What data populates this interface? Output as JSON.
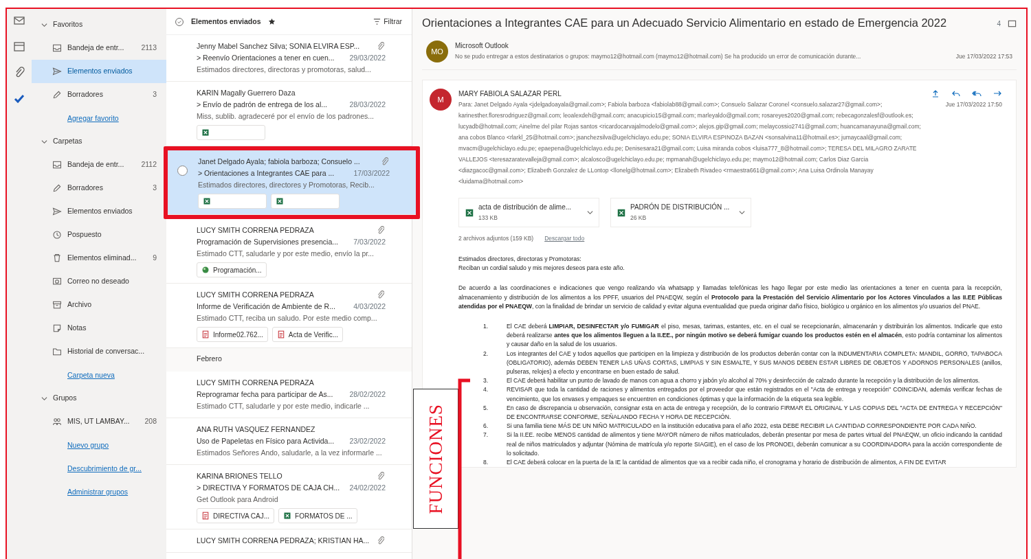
{
  "rail": [
    {
      "kind": "mail"
    },
    {
      "kind": "calendar"
    },
    {
      "kind": "attach"
    },
    {
      "kind": "todo"
    }
  ],
  "folder_sections": [
    {
      "title": "Favoritos",
      "expanded": true,
      "items": [
        {
          "kind": "inbox",
          "label": "Bandeja de entr...",
          "count": "2113",
          "selected": false
        },
        {
          "kind": "sent",
          "label": "Elementos enviados",
          "selected": true
        },
        {
          "kind": "drafts",
          "label": "Borradores",
          "count": "3",
          "selected": false
        }
      ],
      "action": "Agregar favorito"
    },
    {
      "title": "Carpetas",
      "expanded": true,
      "items": [
        {
          "kind": "inbox",
          "label": "Bandeja de entr...",
          "count": "2112",
          "selected": false
        },
        {
          "kind": "drafts",
          "label": "Borradores",
          "count": "3",
          "selected": false
        },
        {
          "kind": "sent",
          "label": "Elementos enviados",
          "selected": false
        },
        {
          "kind": "snooze",
          "label": "Pospuesto",
          "selected": false
        },
        {
          "kind": "trash",
          "label": "Elementos eliminad...",
          "count": "9",
          "selected": false
        },
        {
          "kind": "junk",
          "label": "Correo no deseado",
          "selected": false
        },
        {
          "kind": "archive",
          "label": "Archivo",
          "selected": false
        },
        {
          "kind": "notes",
          "label": "Notas",
          "selected": false
        },
        {
          "kind": "folder",
          "label": "Historial de conversac...",
          "selected": false
        }
      ],
      "action": "Carpeta nueva"
    },
    {
      "title": "Grupos",
      "expanded": true,
      "items": [
        {
          "kind": "group",
          "label": "MIS, UT LAMBAY...",
          "count": "208",
          "selected": false
        }
      ],
      "actions": [
        "Nuevo grupo",
        "Descubrimiento de gr...",
        "Administrar grupos"
      ]
    }
  ],
  "message_list": {
    "title": "Elementos enviados",
    "filter": "Filtrar",
    "groups": [
      {
        "messages": [
          {
            "sender": "Jenny Mabel Sanchez Silva; SONIA ELVIRA ESP...",
            "subject": "> Reenvío Orientaciones a tener en cuen...",
            "date": "29/03/2022",
            "preview": "Estimados directores, directoras y promotoras, salud...",
            "has_attachment": true,
            "selected": false
          },
          {
            "sender": "KARIN Magally Guerrero Daza",
            "subject": "> Envío de padrón de entrega de los al...",
            "date": "28/03/2022",
            "preview": "Miss, sublib. agradeceré por el envío de los padrones...",
            "has_attachment": false,
            "selected": false,
            "attachments": [
              {
                "kind": "excel"
              }
            ]
          },
          {
            "sender": "Janet Delgado Ayala; fabiola barboza; Consuelo ...",
            "subject": "> Orientaciones a Integrantes CAE para ...",
            "date": "17/03/2022",
            "preview": "Estimados directores, directores y Promotoras, Recib...",
            "has_attachment": true,
            "selected": true,
            "attachments": [
              {
                "kind": "excel"
              },
              {
                "kind": "excel"
              }
            ]
          },
          {
            "sender": "LUCY SMITH CORRENA PEDRAZA",
            "subject": "Programación de Supervisiones presencia...",
            "date": "7/03/2022",
            "preview": "Estimado CTT, saludarle y por este medio, envío la pr...",
            "has_attachment": true,
            "selected": false,
            "attachments": [
              {
                "kind": "image",
                "label": "Programación..."
              }
            ]
          },
          {
            "sender": "LUCY SMITH CORRENA PEDRAZA",
            "subject": "Informe de Verificación de Ambiente de R...",
            "date": "4/03/2022",
            "preview": "Estimado CTT, reciba un saludo. Por este medio comp...",
            "has_attachment": true,
            "selected": false,
            "attachments": [
              {
                "kind": "pdf",
                "label": "Informe02.762..."
              },
              {
                "kind": "pdf",
                "label": "Acta de Verific..."
              }
            ]
          }
        ]
      },
      {
        "title": "Febrero",
        "messages": [
          {
            "sender": "LUCY SMITH CORRENA PEDRAZA",
            "subject": "Reprogramar fecha para participar de As...",
            "date": "28/02/2022",
            "preview": "Estimado CTT, saludarle y por este medio, indicarle ...",
            "has_attachment": false,
            "selected": false
          },
          {
            "sender": "ANA RUTH VASQUEZ FERNANDEZ",
            "subject": "Uso de Papeletas en Físico para Activida...",
            "date": "23/02/2022",
            "preview": "Estimados Señores Ando, saludarle, a la vez informarle ...",
            "has_attachment": false,
            "selected": false
          },
          {
            "sender": "KARINA BRIONES TELLO",
            "subject": "> DIRECTIVA Y FORMATOS DE CAJA CH...",
            "date": "24/02/2022",
            "preview": "Get Outlook para Android",
            "has_attachment": true,
            "selected": false,
            "attachments": [
              {
                "kind": "pdf",
                "label": "DIRECTIVA CAJ..."
              },
              {
                "kind": "excel",
                "label": "FORMATOS DE ..."
              }
            ]
          },
          {
            "sender": "LUCY SMITH CORRENA PEDRAZA; KRISTIAN HA...",
            "has_attachment": true,
            "selected": false
          }
        ]
      }
    ]
  },
  "reading_pane": {
    "title": "Orientaciones a Integrantes CAE para un Adecuado Servicio Alimentario en estado de Emergencia 2022",
    "thread_count": "4",
    "collapsed_message": {
      "initials": "MO",
      "color": "#8a6d0b",
      "sender": "Microsoft Outlook",
      "preview": "No se pudo entregar a estos destinatarios o grupos: maymo12@hotmail.com (maymo12@hotmail.com) Se ha producido un error de comunicación durante...",
      "date": "Jue 17/03/2022 17:53"
    },
    "message": {
      "initials": "M",
      "color": "#c4262e",
      "sender": "MARY FABIOLA SALAZAR PERL",
      "date": "Jue 17/03/2022 17:50",
      "recipients": "Para: Janet Delgado Ayala <jdelgadoayala@gmail.com>; Fabiola barboza <fabiolab88@gmail.com>; Consuelo Salazar Coronel <consuelo.salazar27@gmail.com>; karinesther.floresrodriguez@gmail.com; leoalexdeh@gmail.com; anacupicio15@gmail.com; marleyaldo@gmail.com; rosareyes2020@gmail.com; rebecagonzalesf@outlook.es; lucyadb@hotmail.com; Ainelme del pilar Rojas santos <ricardocarvajalmodelo@gmail.com>; alejos.gip@gmail.com; melaycossio2741@gmail.com; huancamanayuna@gmail.com; ana cobos Blanco <rlarkl_25@hotmail.com>; jsanchezsilva@ugelchiclayo.edu.pe; SONIA ELVIRA ESPINOZA BAZAN <sonsalvina11@hotmail.es>; jumaycaal@gmail.com; mvacm@ugelchiclayo.edu.pe; epaepena@ugelchiclayo.edu.pe; Denisesara21@gmail.com; Luisa miranda cobos <luisa777_8@hotmail.com>; TERESA DEL MILAGRO ZARATE VALLEJOS <teresazaratevalleja@gmail.com>; alcalosco@ugelchiclayo.edu.pe; mpmanah@ugelchiclayo.edu.pe; maymo12@hotmail.com; Carlos Diaz Garcia <diazgacoc@gmail.com>; Elizabeth Gonzalez de LLontop <llonelg@hotmail.com>; Elizabeth Rivadeo <rmaestra661@gmail.com>; Ana Luisa Ordinola Manayay <luidama@hotmail.com>",
      "attachments": [
        {
          "kind": "excel",
          "name": "acta de distribución de alime...",
          "size": "133 KB"
        },
        {
          "kind": "excel",
          "name": "PADRÓN DE DISTRIBUCIÓN ...",
          "size": "26 KB"
        }
      ],
      "attachments_summary": "2 archivos adjuntos (159 KB)",
      "download_all": "Descargar todo",
      "greeting": [
        "Estimados directores, directoras y Promotoras:",
        "Reciban un cordial saludo y mis mejores deseos para este año."
      ],
      "intro": "De acuerdo a las coordinaciones e indicaciones que vengo realizando vía whatsapp y llamadas telefónicas les hago llegar por este medio las orientaciones a tener en cuenta para la recepción, almacenamiento y distribución de los alimentos a los PPFF, usuarios del PNAEQW, según el **Protocolo para la Prestación del Servicio Alimentario por los Actores Vinculados a las II.EE Públicas atendidas por el PNAEQW**, con la finalidad de brindar un servicio de calidad y evitar alguna eventualidad que pueda originar daño físico, biológico u orgánico en los alimentos y/o usuarios del PNAE.",
      "items": [
        {
          "number": "1.",
          "text": "El CAE deberá **LIMPIAR, DESINFECTAR y/o FUMIGAR** el piso, mesas, tarimas, estantes, etc. en el cual se recepcionarán, almacenarán y distribuirán los alimentos. Indicarle que esto deberá realizarse **antes que los alimentos lleguen a la II.EE., por ningún motivo se deberá fumigar cuando los productos estén en el almacén**, esto podría contaminar los alimentos y causar daño en la salud de los usuarios."
        },
        {
          "number": "2.",
          "text": "Los integrantes del CAE y todos aquellos que participen en la limpieza y distribución de los productos deberán contar con la INDUMENTARIA COMPLETA: MANDIL, GORRO, TAPABOCA (OBLIGATORIO), además DEBEN TENER LAS UÑAS CORTAS, LIMPIAS Y SIN ESMALTE, Y SUS MANOS DEBEN ESTAR LIBRES DE OBJETOS Y ADORNOS PERSONALES (anillos, pulseras, relojes) a efecto y encontrarse en buen estado de salud."
        },
        {
          "number": "3.",
          "text": "El CAE deberá habilitar un punto de lavado de manos con agua a chorro y jabón y/o alcohol al 70% y desinfección de calzado durante la recepción y la distribución de los alimentos."
        },
        {
          "number": "4.",
          "text": "REVISAR que toda la cantidad de raciones y alimentos entregados por el proveedor que están registrados en el \"Acta de entrega y recepción\" COINCIDAN, además verificar fechas de vencimiento, que los envases y empaques se encuentren en condiciones óptimas y que la información de la etiqueta sea legible."
        },
        {
          "number": "5.",
          "text": "En caso de discrepancia u observación, consignar esta en acta de entrega y recepción, de lo contrario FIRMAR EL ORIGINAL Y LAS COPIAS DEL \"ACTA DE ENTREGA Y RECEPCIÓN\" DE ENCONTRARSE CONFORME, SEÑALANDO FECHA Y HORA DE RECEPCIÓN."
        },
        {
          "number": "6.",
          "text": "Si una familia tiene MÁS DE UN NIÑO MATRICULADO en la institución educativa para el año 2022, esta DEBE RECIBIR LA CANTIDAD CORRESPONDIENTE POR CADA NIÑO."
        },
        {
          "number": "7.",
          "text": "Si la II.EE. recibe MENOS cantidad de alimentos y tiene MAYOR número de niños matriculados, deberán presentar por mesa de partes virtual del PNAEQW, un oficio indicando la cantidad real de niños matriculados y adjuntar (Nómina de matrícula y/o reporte SIAGIE), en el caso de los PRONOEI, deberán comunicar a su COORDINADORA para la acción correspondiente de lo solicitado."
        },
        {
          "number": "8.",
          "text": "El CAE deberá colocar en la puerta de la IE la cantidad de alimentos que va a recibir cada niño, el cronograma y horario de distribución de alimentos, A FIN DE EVITAR"
        }
      ]
    }
  },
  "annotation": {
    "label": "FUNCIONES"
  }
}
